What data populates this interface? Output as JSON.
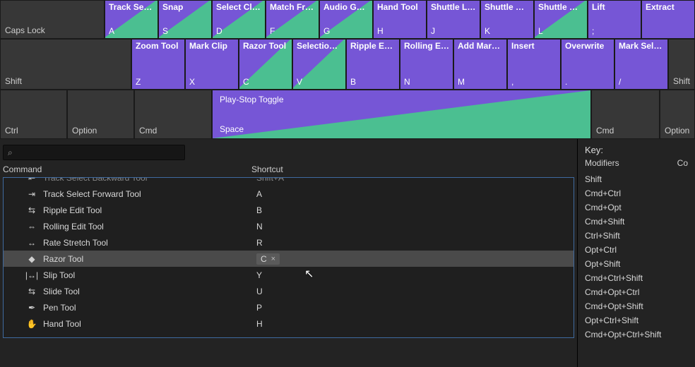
{
  "rows": {
    "caps": {
      "modLabel": "Caps Lock",
      "keys": [
        {
          "top": "Track Select...",
          "letter": "A",
          "tri": true
        },
        {
          "top": "Snap",
          "letter": "S",
          "tri": true
        },
        {
          "top": "Select Clip at...",
          "letter": "D",
          "tri": true
        },
        {
          "top": "Match Frame",
          "letter": "F",
          "tri": true
        },
        {
          "top": "Audio Gain...",
          "letter": "G",
          "tri": true
        },
        {
          "top": "Hand Tool",
          "letter": "H",
          "tri": false
        },
        {
          "top": "Shuttle Left",
          "letter": "J",
          "tri": false
        },
        {
          "top": "Shuttle Stop",
          "letter": "K",
          "tri": false
        },
        {
          "top": "Shuttle Right",
          "letter": "L",
          "tri": true
        },
        {
          "top": "Lift",
          "letter": ";",
          "tri": false
        },
        {
          "top": "Extract",
          "letter": "",
          "tri": false
        }
      ]
    },
    "shift": {
      "modLabel": "Shift",
      "keys": [
        {
          "top": "Zoom Tool",
          "letter": "Z",
          "tri": false
        },
        {
          "top": "Mark Clip",
          "letter": "X",
          "tri": false
        },
        {
          "top": "Razor Tool",
          "letter": "C",
          "tri": true
        },
        {
          "top": "Selection Tool",
          "letter": "V",
          "tri": true
        },
        {
          "top": "Ripple Edit Tool",
          "letter": "B",
          "tri": false
        },
        {
          "top": "Rolling Edit Tool",
          "letter": "N",
          "tri": false
        },
        {
          "top": "Add Marker",
          "letter": "M",
          "tri": false
        },
        {
          "top": "Insert",
          "letter": ",",
          "tri": false
        },
        {
          "top": "Overwrite",
          "letter": ".",
          "tri": false
        },
        {
          "top": "Mark Selection",
          "letter": "/",
          "tri": false
        }
      ],
      "rightMod": "Shift"
    },
    "bottom": {
      "ctrl": "Ctrl",
      "option": "Option",
      "cmdL": "Cmd",
      "space": {
        "top": "Play-Stop Toggle",
        "bottom": "Space"
      },
      "cmdR": "Cmd",
      "optR": "Option"
    }
  },
  "search": {
    "placeholder": ""
  },
  "columns": {
    "command": "Command",
    "shortcut": "Shortcut"
  },
  "commands": [
    {
      "icon": "⇤",
      "name": "Track Select Backward Tool",
      "shortcut": "Shift+A",
      "clipped": true
    },
    {
      "icon": "⇥",
      "name": "Track Select Forward Tool",
      "shortcut": "A"
    },
    {
      "icon": "⇆",
      "name": "Ripple Edit Tool",
      "shortcut": "B"
    },
    {
      "icon": "⇔",
      "name": "Rolling Edit Tool",
      "shortcut": "N"
    },
    {
      "icon": "↔",
      "name": "Rate Stretch Tool",
      "shortcut": "R"
    },
    {
      "icon": "◆",
      "name": "Razor Tool",
      "shortcut": "C",
      "selected": true
    },
    {
      "icon": "|↔|",
      "name": "Slip Tool",
      "shortcut": "Y"
    },
    {
      "icon": "⇆",
      "name": "Slide Tool",
      "shortcut": "U"
    },
    {
      "icon": "✒",
      "name": "Pen Tool",
      "shortcut": "P"
    },
    {
      "icon": "✋",
      "name": "Hand Tool",
      "shortcut": "H"
    }
  ],
  "clearX": "×",
  "rightPanel": {
    "keyLabel": "Key:",
    "modifiersLabel": "Modifiers",
    "coLabel": "Co",
    "modifiers": [
      "Shift",
      "Cmd+Ctrl",
      "Cmd+Opt",
      "Cmd+Shift",
      "Ctrl+Shift",
      "Opt+Ctrl",
      "Opt+Shift",
      "Cmd+Ctrl+Shift",
      "Cmd+Opt+Ctrl",
      "Cmd+Opt+Shift",
      "Opt+Ctrl+Shift",
      "Cmd+Opt+Ctrl+Shift"
    ]
  }
}
